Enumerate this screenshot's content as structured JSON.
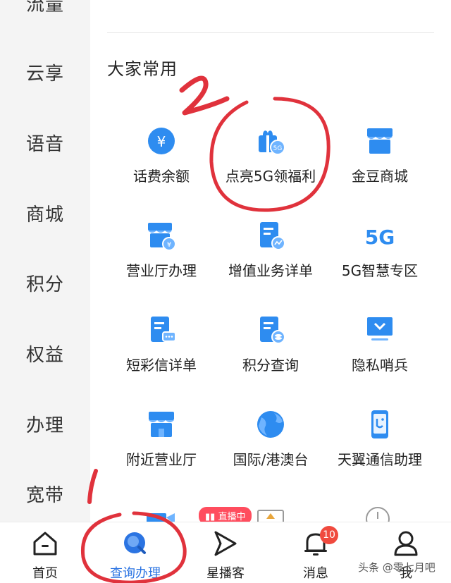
{
  "sidebar": {
    "items": [
      {
        "label": "流量"
      },
      {
        "label": "云享"
      },
      {
        "label": "语音"
      },
      {
        "label": "商城"
      },
      {
        "label": "积分"
      },
      {
        "label": "权益"
      },
      {
        "label": "办理"
      },
      {
        "label": "宽带"
      }
    ]
  },
  "main": {
    "section_title": "大家常用",
    "grid": [
      {
        "label": "话费余额",
        "icon": "yuan-coin-icon"
      },
      {
        "label": "点亮5G领福利",
        "icon": "gift-5g-icon"
      },
      {
        "label": "金豆商城",
        "icon": "shop-icon"
      },
      {
        "label": "营业厅办理",
        "icon": "store-yuan-icon"
      },
      {
        "label": "增值业务详单",
        "icon": "document-chart-icon"
      },
      {
        "label": "5G智慧专区",
        "icon": "5g-logo-icon"
      },
      {
        "label": "短彩信详单",
        "icon": "document-message-icon"
      },
      {
        "label": "积分查询",
        "icon": "document-coins-icon"
      },
      {
        "label": "隐私哨兵",
        "icon": "monitor-shield-icon"
      },
      {
        "label": "附近营业厅",
        "icon": "nearby-store-icon"
      },
      {
        "label": "国际/港澳台",
        "icon": "globe-icon"
      },
      {
        "label": "天翼通信助理",
        "icon": "phone-assistant-icon"
      }
    ],
    "live_badge": "直播中"
  },
  "bottom_nav": {
    "items": [
      {
        "label": "首页",
        "icon": "home-icon"
      },
      {
        "label": "查询办理",
        "icon": "search-icon",
        "active": true
      },
      {
        "label": "星播客",
        "icon": "play-arrow-icon"
      },
      {
        "label": "消息",
        "icon": "bell-icon",
        "badge": "10"
      },
      {
        "label": "我",
        "icon": "user-icon"
      }
    ]
  },
  "watermark": "头条 @零七月吧",
  "colors": {
    "accent_blue": "#2b74e2",
    "icon_blue": "#2e8cf0",
    "badge_red": "#f04a3e",
    "annotation_red": "#e0323c",
    "sidebar_bg": "#f4f4f4"
  }
}
